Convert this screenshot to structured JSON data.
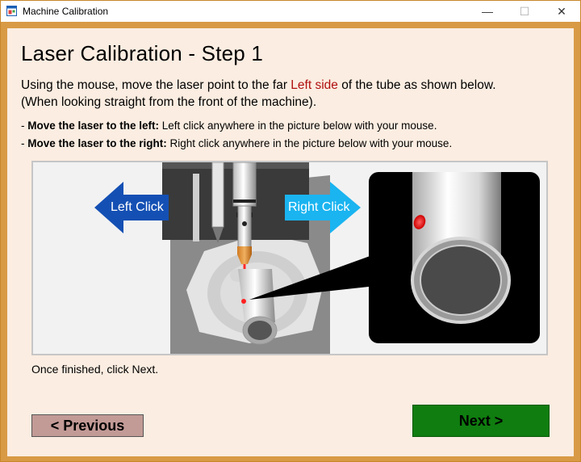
{
  "window": {
    "title": "Machine Calibration",
    "minimize_glyph": "—",
    "maximize_glyph": "☐",
    "close_glyph": "✕"
  },
  "page": {
    "heading": "Laser Calibration - Step 1",
    "instruction_before": "Using the mouse, move the laser point to the far ",
    "instruction_highlight": "Left side",
    "instruction_after": " of the tube as shown below.",
    "instruction_line2": "(When looking straight from the front of the machine).",
    "bullet_left_prefix": "- ",
    "bullet_left_bold": "Move the laser to the left:",
    "bullet_left_text": " Left click anywhere in the picture below with your mouse.",
    "bullet_right_prefix": "- ",
    "bullet_right_bold": "Move the laser to the right:",
    "bullet_right_text": " Right click anywhere in the picture below with your mouse.",
    "picture": {
      "left_arrow_label": "Left Click",
      "right_arrow_label": "Right Click",
      "left_arrow_color": "#1450b4",
      "right_arrow_color": "#1ab4f0"
    },
    "finished_text": "Once finished, click Next."
  },
  "buttons": {
    "previous_label": "< Previous",
    "next_label": "Next >"
  },
  "colors": {
    "window_border": "#d99a45",
    "client_bg": "#fbede1",
    "highlight_text": "#b01010",
    "previous_bg": "#c29a96",
    "next_bg": "#0f7d0f"
  }
}
